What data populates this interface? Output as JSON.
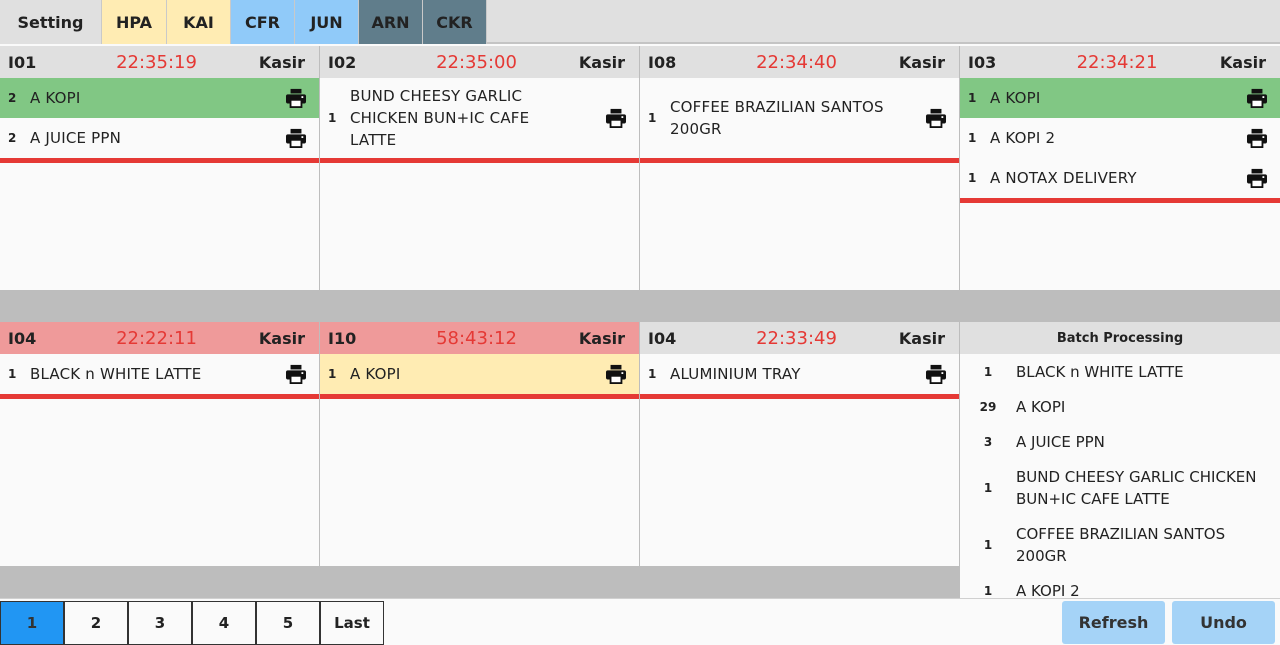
{
  "tabs": [
    {
      "label": "Setting",
      "color": "#e0e0e0"
    },
    {
      "label": "HPA",
      "color": "#ffecb3"
    },
    {
      "label": "KAI",
      "color": "#ffecb3"
    },
    {
      "label": "CFR",
      "color": "#90caf9"
    },
    {
      "label": "JUN",
      "color": "#90caf9"
    },
    {
      "label": "ARN",
      "color": "#607d8b"
    },
    {
      "label": "CKR",
      "color": "#607d8b"
    }
  ],
  "tickets": [
    {
      "id": "I01",
      "time": "22:35:19",
      "cashier": "Kasir",
      "header_color": "#e0e0e0",
      "items": [
        {
          "qty": "2",
          "name": "A KOPI",
          "highlight": "green"
        },
        {
          "qty": "2",
          "name": "A JUICE PPN",
          "highlight": ""
        }
      ]
    },
    {
      "id": "I02",
      "time": "22:35:00",
      "cashier": "Kasir",
      "header_color": "#e0e0e0",
      "items": [
        {
          "qty": "1",
          "name": "BUND CHEESY GARLIC CHICKEN BUN+IC CAFE LATTE",
          "highlight": ""
        }
      ]
    },
    {
      "id": "I08",
      "time": "22:34:40",
      "cashier": "Kasir",
      "header_color": "#e0e0e0",
      "items": [
        {
          "qty": "1",
          "name": "COFFEE BRAZILIAN SANTOS 200GR",
          "highlight": ""
        }
      ]
    },
    {
      "id": "I03",
      "time": "22:34:21",
      "cashier": "Kasir",
      "header_color": "#e0e0e0",
      "items": [
        {
          "qty": "1",
          "name": "A KOPI",
          "highlight": "green"
        },
        {
          "qty": "1",
          "name": "A KOPI 2",
          "highlight": ""
        },
        {
          "qty": "1",
          "name": "A NOTAX DELIVERY",
          "highlight": ""
        }
      ]
    },
    {
      "id": "I04",
      "time": "22:22:11",
      "cashier": "Kasir",
      "header_color": "#ef9a9a",
      "items": [
        {
          "qty": "1",
          "name": "BLACK n WHITE LATTE",
          "highlight": ""
        }
      ]
    },
    {
      "id": "I10",
      "time": "58:43:12",
      "cashier": "Kasir",
      "header_color": "#ef9a9a",
      "items": [
        {
          "qty": "1",
          "name": "A KOPI",
          "highlight": "yellow"
        }
      ]
    },
    {
      "id": "I04",
      "time": "22:33:49",
      "cashier": "Kasir",
      "header_color": "#e0e0e0",
      "items": [
        {
          "qty": "1",
          "name": "ALUMINIUM TRAY",
          "highlight": ""
        }
      ]
    }
  ],
  "batch": {
    "title": "Batch Processing",
    "items": [
      {
        "qty": "1",
        "name": "BLACK n WHITE LATTE"
      },
      {
        "qty": "29",
        "name": "A KOPI"
      },
      {
        "qty": "3",
        "name": "A JUICE PPN"
      },
      {
        "qty": "1",
        "name": "BUND CHEESY GARLIC CHICKEN BUN+IC CAFE LATTE"
      },
      {
        "qty": "1",
        "name": "COFFEE BRAZILIAN SANTOS 200GR"
      },
      {
        "qty": "1",
        "name": "A KOPI 2"
      }
    ]
  },
  "pagination": {
    "pages": [
      "1",
      "2",
      "3",
      "4",
      "5"
    ],
    "last_label": "Last",
    "active": "1"
  },
  "actions": {
    "refresh_label": "Refresh",
    "undo_label": "Undo"
  },
  "colors": {
    "time_red": "#e53935",
    "line_red": "#e53935",
    "green": "#81c784",
    "yellow": "#ffecb3",
    "active_page": "#2196f3",
    "action_button": "#a5d3f7"
  }
}
